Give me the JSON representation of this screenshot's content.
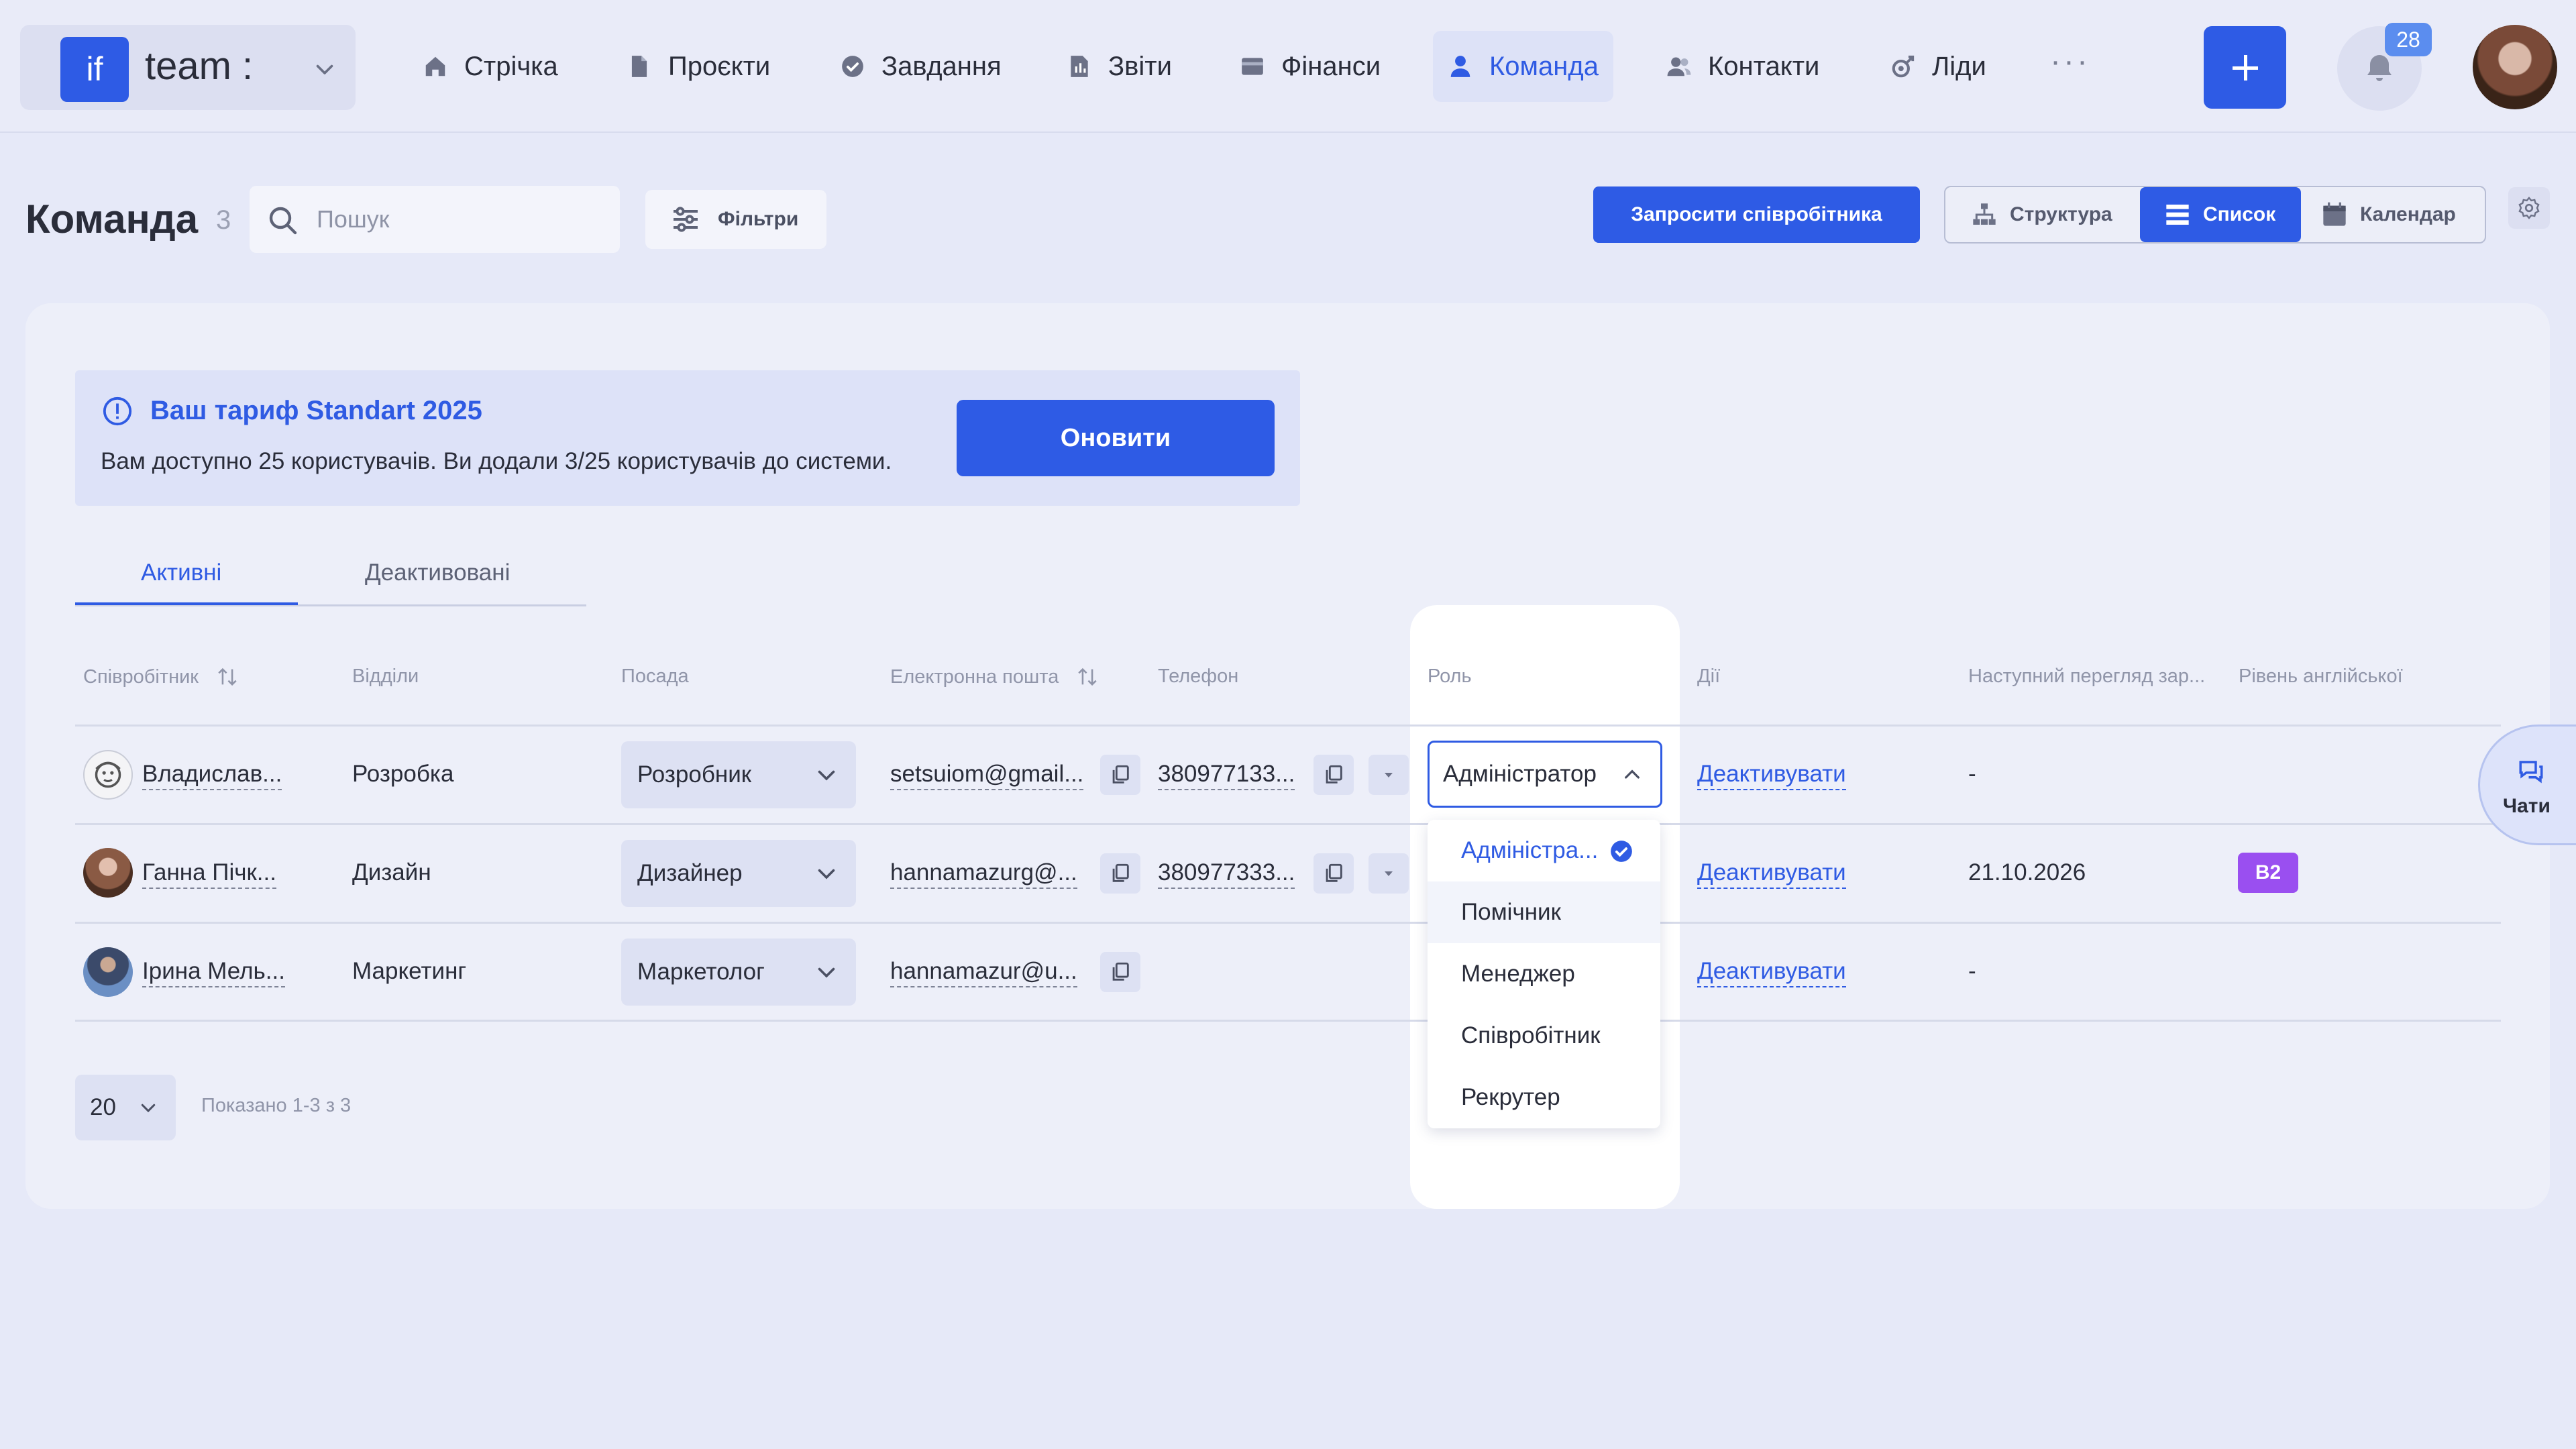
{
  "brand": {
    "logo_text": "if",
    "name": "team :"
  },
  "nav": {
    "items": [
      {
        "label": "Стрічка",
        "icon": "home-icon"
      },
      {
        "label": "Проєкти",
        "icon": "document-icon"
      },
      {
        "label": "Завдання",
        "icon": "check-circle-icon"
      },
      {
        "label": "Звіти",
        "icon": "report-icon"
      },
      {
        "label": "Фінанси",
        "icon": "wallet-icon"
      },
      {
        "label": "Команда",
        "icon": "user-icon",
        "active": true
      },
      {
        "label": "Контакти",
        "icon": "contacts-icon"
      },
      {
        "label": "Ліди",
        "icon": "leads-icon"
      }
    ],
    "more": "···",
    "notifications_count": "28"
  },
  "header": {
    "title": "Команда",
    "count": "3",
    "search_placeholder": "Пошук",
    "filters_label": "Фільтри",
    "invite_label": "Запросити співробітника",
    "views": {
      "structure": "Структура",
      "list": "Список",
      "calendar": "Календар"
    }
  },
  "plan": {
    "title": "Ваш тариф Standart 2025",
    "text": "Вам доступно 25 користувачів. Ви додали 3/25 користувачів до системи.",
    "button": "Оновити"
  },
  "tabs": {
    "active": "Активні",
    "inactive": "Деактивовані"
  },
  "table": {
    "headers": {
      "employee": "Співробітник",
      "department": "Відділи",
      "position": "Посада",
      "email": "Електронна пошта",
      "phone": "Телефон",
      "role": "Роль",
      "actions": "Дії",
      "next_review": "Наступний перегляд зар...",
      "english": "Рівень англійської"
    },
    "rows": [
      {
        "name": "Владислав...",
        "department": "Розробка",
        "position": "Розробник",
        "email": "setsuiom@gmail...",
        "phone": "380977133...",
        "role": "Адміністратор",
        "action": "Деактивувати",
        "next_review": "-",
        "english": ""
      },
      {
        "name": "Ганна Пічк...",
        "department": "Дизайн",
        "position": "Дизайнер",
        "email": "hannamazurg@...",
        "phone": "380977333...",
        "role": "",
        "action": "Деактивувати",
        "next_review": "21.10.2026",
        "english": "B2"
      },
      {
        "name": "Ірина Мель...",
        "department": "Маркетинг",
        "position": "Маркетолог",
        "email": "hannamazur@u...",
        "phone": "",
        "role": "",
        "action": "Деактивувати",
        "next_review": "-",
        "english": ""
      }
    ]
  },
  "role_dropdown": {
    "options": [
      "Адміністра...",
      "Помічник",
      "Менеджер",
      "Співробітник",
      "Рекрутер"
    ],
    "selected": "Адміністра...",
    "hovered": "Помічник"
  },
  "chats": {
    "label": "Чати"
  },
  "pagination": {
    "per_page": "20",
    "shown": "Показано 1-3 з 3"
  },
  "colors": {
    "accent": "#2e5be5",
    "background": "#e6e9f8",
    "badge_b2": "#9a4ff0"
  }
}
